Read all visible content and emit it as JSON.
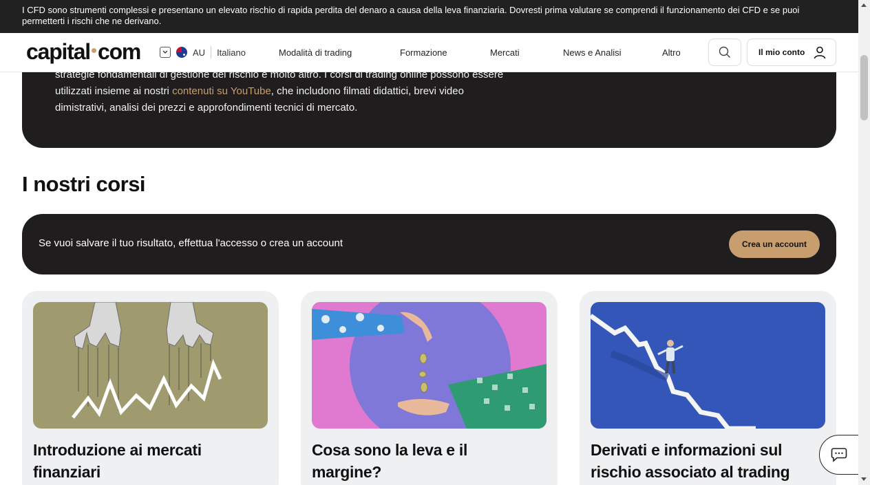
{
  "risk_warning": "I CFD sono strumenti complessi e presentano un elevato rischio di rapida perdita del denaro a causa della leva finanziaria. Dovresti prima valutare se comprendi il funzionamento dei CFD e se puoi permetterti i rischi che ne derivano.",
  "header": {
    "logo_left": "capital",
    "logo_right": "com",
    "region_code": "AU",
    "language": "Italiano",
    "nav": [
      "Modalità di trading",
      "Formazione",
      "Mercati",
      "News e Analisi",
      "Altro"
    ],
    "account_label": "Il mio conto"
  },
  "intro": {
    "line1": "strategie fondamentali di gestione del rischio e molto altro. I corsi di trading online possono essere",
    "line2_before": "utilizzati insieme ai nostri ",
    "line2_link": "contenuti su YouTube",
    "line2_after": ", che includono filmati didattici, brevi video",
    "line3": "dimistrativi, analisi dei prezzi e approfondimenti tecnici di mercato."
  },
  "section_title": "I nostri corsi",
  "save_banner": {
    "text": "Se vuoi salvare il tuo risultato, effettua l'accesso o crea un account",
    "button": "Crea un account"
  },
  "courses": [
    {
      "title": "Introduzione ai mercati finanziari",
      "icon": "puppet-hands-chart-image"
    },
    {
      "title": "Cosa sono la leva e il margine?",
      "icon": "coins-dropping-hands-image"
    },
    {
      "title": "Derivati e informazioni sul rischio associato al trading",
      "icon": "man-on-falling-chart-image"
    }
  ],
  "colors": {
    "accent": "#c99e6f",
    "dark": "#1f1d1d",
    "card_bg": "#eff0f2"
  }
}
